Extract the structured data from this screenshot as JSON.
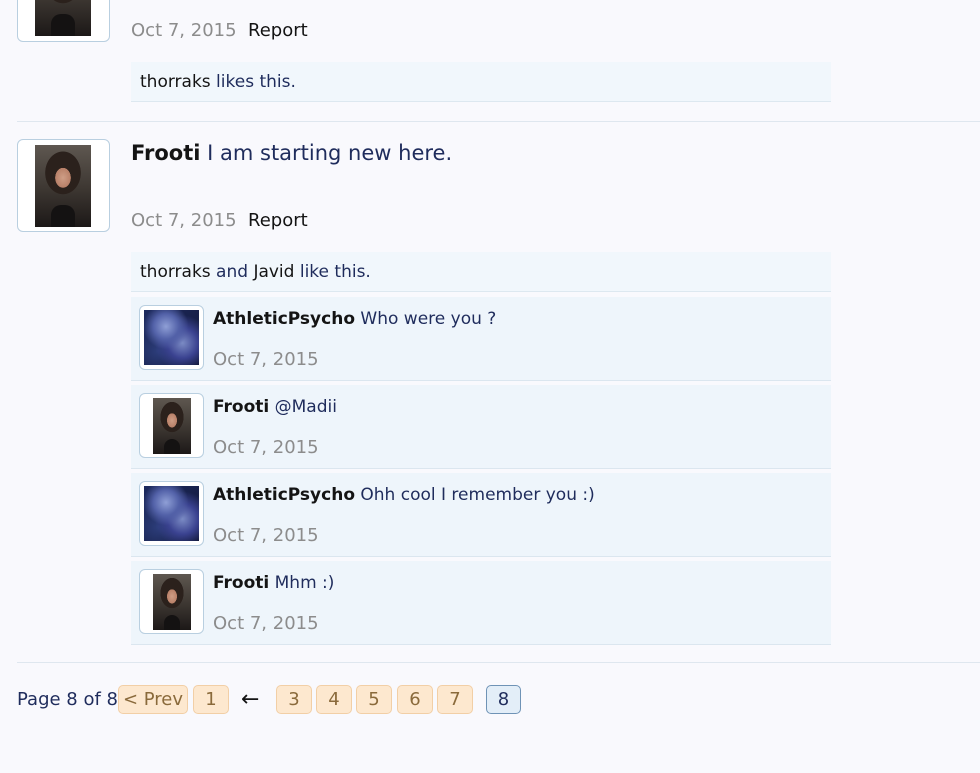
{
  "top_post": {
    "date": "Oct 7, 2015",
    "report_label": "Report",
    "likes": {
      "users": [
        "thorraks"
      ],
      "suffix": " likes this."
    }
  },
  "main_post": {
    "author": "Frooti",
    "message": " I am starting new here.",
    "date": "Oct 7, 2015",
    "report_label": "Report",
    "likes": {
      "user1": "thorraks",
      "joiner": " and ",
      "user2": "Javid",
      "suffix": " like this."
    }
  },
  "comments": [
    {
      "author": "AthleticPsycho",
      "text": " Who were you ?",
      "date": "Oct 7, 2015",
      "avatar": "athletic"
    },
    {
      "author": "Frooti",
      "text": " @Madii",
      "date": "Oct 7, 2015",
      "avatar": "frooti"
    },
    {
      "author": "AthleticPsycho",
      "text": " Ohh cool I remember you :)",
      "date": "Oct 7, 2015",
      "avatar": "athletic"
    },
    {
      "author": "Frooti",
      "text": " Mhm :)",
      "date": "Oct 7, 2015",
      "avatar": "frooti"
    }
  ],
  "pagination": {
    "label": "Page 8 of 8",
    "prev_label": "< Prev",
    "arrow": "←",
    "pages": [
      "1",
      "3",
      "4",
      "5",
      "6",
      "7",
      "8"
    ],
    "current": "8"
  },
  "colors": {
    "accent_text": "#1f2c5c",
    "page_button_bg": "#fde8cf",
    "current_page_border": "#6f93b6"
  }
}
